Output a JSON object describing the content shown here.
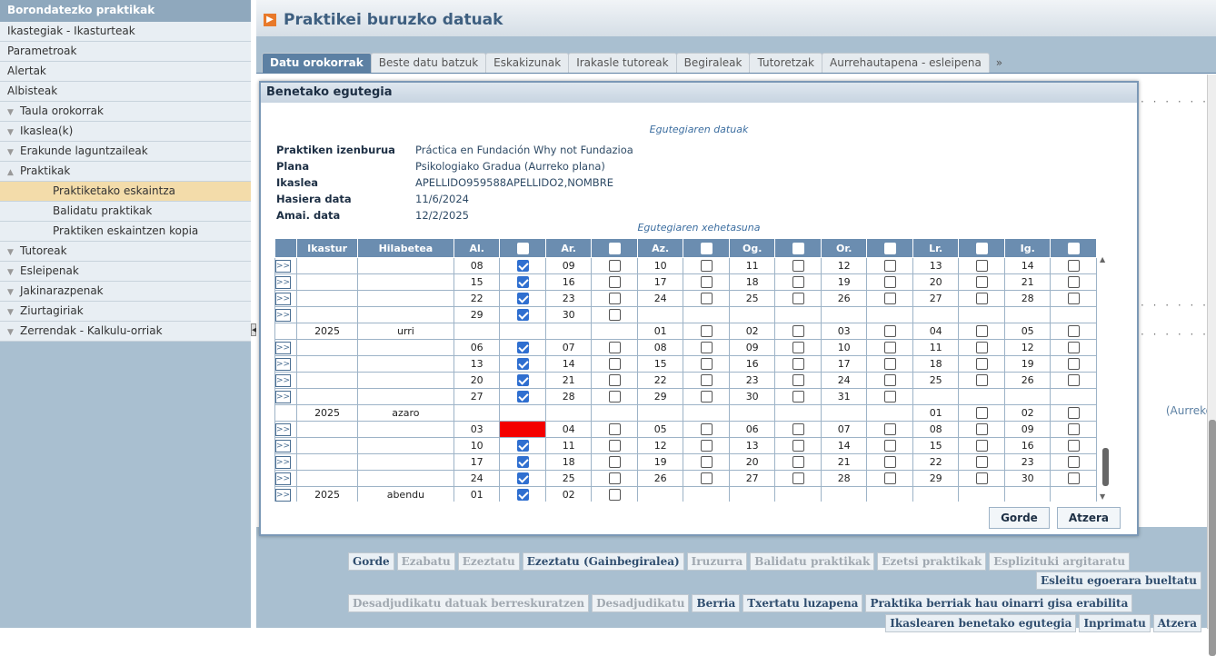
{
  "sidebar": {
    "header": "Borondatezko praktikak",
    "items": [
      {
        "label": "Ikastegiak - Ikasturteak",
        "type": "plain"
      },
      {
        "label": "Parametroak",
        "type": "plain"
      },
      {
        "label": "Alertak",
        "type": "plain"
      },
      {
        "label": "Albisteak",
        "type": "plain"
      },
      {
        "label": "Taula orokorrak",
        "type": "group"
      },
      {
        "label": "Ikaslea(k)",
        "type": "group"
      },
      {
        "label": "Erakunde laguntzaileak",
        "type": "group"
      },
      {
        "label": "Praktikak",
        "type": "open-group"
      },
      {
        "label": "Praktiketako eskaintza",
        "type": "sub-active"
      },
      {
        "label": "Balidatu praktikak",
        "type": "sub"
      },
      {
        "label": "Praktiken eskaintzen kopia",
        "type": "sub"
      },
      {
        "label": "Tutoreak",
        "type": "group"
      },
      {
        "label": "Esleipenak",
        "type": "group"
      },
      {
        "label": "Jakinarazpenak",
        "type": "group"
      },
      {
        "label": "Ziurtagiriak",
        "type": "group"
      },
      {
        "label": "Zerrendak - Kalkulu-orriak",
        "type": "group"
      }
    ]
  },
  "main": {
    "title": "Praktikei buruzko datuak",
    "tabs": [
      "Datu orokorrak",
      "Beste datu batzuk",
      "Eskakizunak",
      "Irakasle tutoreak",
      "Begiraleak",
      "Tutoretzak",
      "Aurrehautapena - esleipena"
    ],
    "tab_more": "»",
    "aurreko_text": "(Aurreko",
    "button_rows": [
      [
        {
          "label": "Gorde",
          "enabled": true
        },
        {
          "label": "Ezabatu",
          "enabled": false
        },
        {
          "label": "Ezeztatu",
          "enabled": false
        },
        {
          "label": "Ezeztatu (Gainbegiralea)",
          "enabled": true
        },
        {
          "label": "Iruzurra",
          "enabled": false
        },
        {
          "label": "Balidatu praktikak",
          "enabled": false
        },
        {
          "label": "Ezetsi praktikak",
          "enabled": false
        },
        {
          "label": "Esplizituki argitaratu",
          "enabled": false
        }
      ],
      [
        {
          "label": "Esleitu egoerara bueltatu",
          "enabled": true
        }
      ],
      [
        {
          "label": "Desadjudikatu datuak berreskuratzen",
          "enabled": false
        },
        {
          "label": "Desadjudikatu",
          "enabled": false
        },
        {
          "label": "Berria",
          "enabled": true
        },
        {
          "label": "Txertatu luzapena",
          "enabled": true
        },
        {
          "label": "Praktika berriak hau oinarri gisa erabilita",
          "enabled": true
        }
      ],
      [
        {
          "label": "Ikaslearen benetako egutegia",
          "enabled": true
        },
        {
          "label": "Inprimatu",
          "enabled": true
        },
        {
          "label": "Atzera",
          "enabled": true
        }
      ]
    ]
  },
  "modal": {
    "title": "Benetako egutegia",
    "caption_data": "Egutegiaren datuak",
    "caption_detail": "Egutegiaren xehetasuna",
    "info": [
      {
        "key": "Praktiken izenburua",
        "value": "Práctica en Fundación Why not Fundazioa"
      },
      {
        "key": "Plana",
        "value": "Psikologiako Gradua (Aurreko plana)"
      },
      {
        "key": "Ikaslea",
        "value": "APELLIDO959588APELLIDO2,NOMBRE"
      },
      {
        "key": "Hasiera data",
        "value": "11/6/2024"
      },
      {
        "key": "Amai. data",
        "value": "12/2/2025"
      }
    ],
    "columns": [
      "",
      "Ikastur",
      "Hilabetea",
      "Al.",
      "",
      "Ar.",
      "",
      "Az.",
      "",
      "Og.",
      "",
      "Or.",
      "",
      "Lr.",
      "",
      "Ig.",
      ""
    ],
    "expand_label": ">>",
    "rows": [
      {
        "exp": true,
        "year": "",
        "month": "",
        "d": [
          [
            "08",
            "on"
          ],
          [
            "09",
            "off"
          ],
          [
            "10",
            "off"
          ],
          [
            "11",
            "off"
          ],
          [
            "12",
            "off"
          ],
          [
            "13",
            "off"
          ],
          [
            "14",
            "off"
          ]
        ]
      },
      {
        "exp": true,
        "year": "",
        "month": "",
        "d": [
          [
            "15",
            "on"
          ],
          [
            "16",
            "off"
          ],
          [
            "17",
            "off"
          ],
          [
            "18",
            "off"
          ],
          [
            "19",
            "off"
          ],
          [
            "20",
            "off"
          ],
          [
            "21",
            "off"
          ]
        ]
      },
      {
        "exp": true,
        "year": "",
        "month": "",
        "d": [
          [
            "22",
            "on"
          ],
          [
            "23",
            "off"
          ],
          [
            "24",
            "off"
          ],
          [
            "25",
            "off"
          ],
          [
            "26",
            "off"
          ],
          [
            "27",
            "off"
          ],
          [
            "28",
            "off"
          ]
        ]
      },
      {
        "exp": true,
        "year": "",
        "month": "",
        "d": [
          [
            "29",
            "on"
          ],
          [
            "30",
            "off"
          ],
          [
            "",
            ""
          ],
          [
            "",
            ""
          ],
          [
            "",
            ""
          ],
          [
            "",
            ""
          ],
          [
            "",
            ""
          ]
        ]
      },
      {
        "exp": false,
        "year": "2025",
        "month": "urri",
        "d": [
          [
            "",
            ""
          ],
          [
            "",
            ""
          ],
          [
            "01",
            "off"
          ],
          [
            "02",
            "off"
          ],
          [
            "03",
            "off"
          ],
          [
            "04",
            "off"
          ],
          [
            "05",
            "off"
          ]
        ]
      },
      {
        "exp": true,
        "year": "",
        "month": "",
        "d": [
          [
            "06",
            "on"
          ],
          [
            "07",
            "off"
          ],
          [
            "08",
            "off"
          ],
          [
            "09",
            "off"
          ],
          [
            "10",
            "off"
          ],
          [
            "11",
            "off"
          ],
          [
            "12",
            "off"
          ]
        ]
      },
      {
        "exp": true,
        "year": "",
        "month": "",
        "d": [
          [
            "13",
            "on"
          ],
          [
            "14",
            "off"
          ],
          [
            "15",
            "off"
          ],
          [
            "16",
            "off"
          ],
          [
            "17",
            "off"
          ],
          [
            "18",
            "off"
          ],
          [
            "19",
            "off"
          ]
        ]
      },
      {
        "exp": true,
        "year": "",
        "month": "",
        "d": [
          [
            "20",
            "on"
          ],
          [
            "21",
            "off"
          ],
          [
            "22",
            "off"
          ],
          [
            "23",
            "off"
          ],
          [
            "24",
            "off"
          ],
          [
            "25",
            "off"
          ],
          [
            "26",
            "off"
          ]
        ]
      },
      {
        "exp": true,
        "year": "",
        "month": "",
        "d": [
          [
            "27",
            "on"
          ],
          [
            "28",
            "off"
          ],
          [
            "29",
            "off"
          ],
          [
            "30",
            "off"
          ],
          [
            "31",
            "off"
          ],
          [
            "",
            ""
          ],
          [
            "",
            ""
          ]
        ]
      },
      {
        "exp": false,
        "year": "2025",
        "month": "azaro",
        "d": [
          [
            "",
            ""
          ],
          [
            "",
            ""
          ],
          [
            "",
            ""
          ],
          [
            "",
            ""
          ],
          [
            "",
            ""
          ],
          [
            "01",
            "off"
          ],
          [
            "02",
            "off"
          ]
        ]
      },
      {
        "exp": true,
        "year": "",
        "month": "",
        "d": [
          [
            "03",
            "red"
          ],
          [
            "04",
            "off"
          ],
          [
            "05",
            "off"
          ],
          [
            "06",
            "off"
          ],
          [
            "07",
            "off"
          ],
          [
            "08",
            "off"
          ],
          [
            "09",
            "off"
          ]
        ]
      },
      {
        "exp": true,
        "year": "",
        "month": "",
        "d": [
          [
            "10",
            "on"
          ],
          [
            "11",
            "off"
          ],
          [
            "12",
            "off"
          ],
          [
            "13",
            "off"
          ],
          [
            "14",
            "off"
          ],
          [
            "15",
            "off"
          ],
          [
            "16",
            "off"
          ]
        ]
      },
      {
        "exp": true,
        "year": "",
        "month": "",
        "d": [
          [
            "17",
            "on"
          ],
          [
            "18",
            "off"
          ],
          [
            "19",
            "off"
          ],
          [
            "20",
            "off"
          ],
          [
            "21",
            "off"
          ],
          [
            "22",
            "off"
          ],
          [
            "23",
            "off"
          ]
        ]
      },
      {
        "exp": true,
        "year": "",
        "month": "",
        "d": [
          [
            "24",
            "on"
          ],
          [
            "25",
            "off"
          ],
          [
            "26",
            "off"
          ],
          [
            "27",
            "off"
          ],
          [
            "28",
            "off"
          ],
          [
            "29",
            "off"
          ],
          [
            "30",
            "off"
          ]
        ]
      },
      {
        "exp": true,
        "year": "2025",
        "month": "abendu",
        "d": [
          [
            "01",
            "on"
          ],
          [
            "02",
            "off"
          ],
          [
            "",
            ""
          ],
          [
            "",
            ""
          ],
          [
            "",
            ""
          ],
          [
            "",
            ""
          ],
          [
            "",
            ""
          ]
        ]
      }
    ],
    "buttons": [
      "Gorde",
      "Atzera"
    ]
  },
  "colors": {
    "accent": "#5c80a3",
    "sidebar_bg": "#a9bfd0",
    "highlight": "#f3dcaa",
    "blocked_day": "#f40000",
    "check": "#2f6fd0"
  }
}
